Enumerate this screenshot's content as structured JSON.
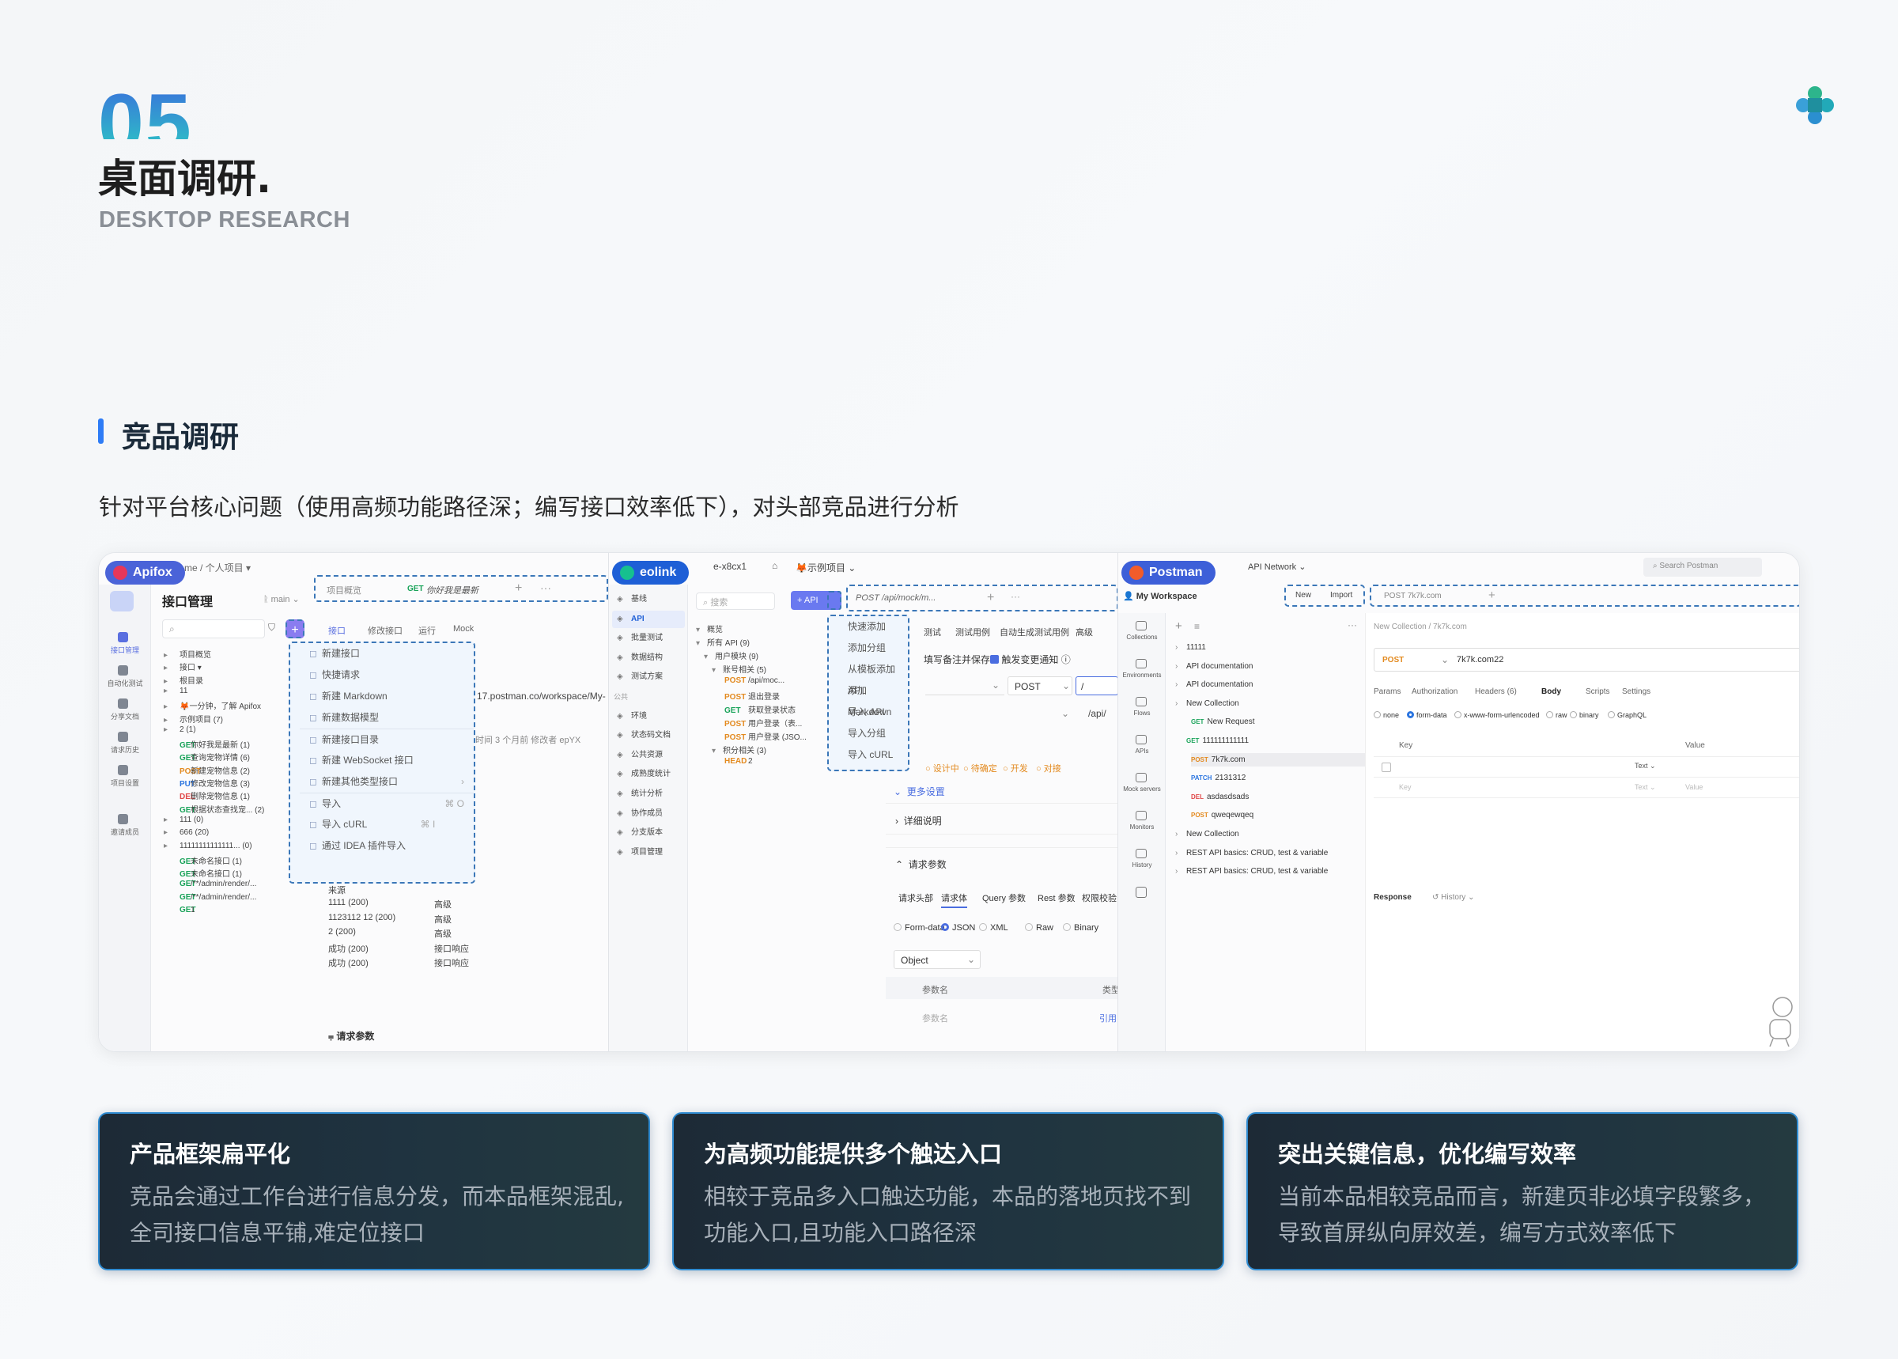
{
  "header": {
    "number": "05",
    "title": "桌面调研.",
    "subtitle": "DESKTOP RESEARCH"
  },
  "section": {
    "title": "竞品调研",
    "desc": "针对平台核心问题（使用高频功能路径深；编写接口效率低下），对头部竞品进行分析"
  },
  "apifox": {
    "brand": "Apifox",
    "breadcrumb": "me / 个人项目 ▾",
    "module_title": "接口管理",
    "branch": "main",
    "tab_overview": "项目概览",
    "tab_get": "GET",
    "tab_title": "你好我是最新",
    "subtabs": [
      "接口",
      "修改接口",
      "运行",
      "Mock"
    ],
    "sidebar": [
      "接口管理",
      "自动化测试",
      "分享文档",
      "请求历史",
      "项目设置",
      "邀请成员"
    ],
    "menu": [
      "新建接口",
      "快捷请求",
      "新建 Markdown",
      "新建数据模型",
      "新建接口目录",
      "新建 WebSocket 接口",
      "新建其他类型接口",
      "导入",
      "导入 cURL",
      "通过 IDEA 插件导入"
    ],
    "menu_shortcuts": {
      "import": "⌘ O",
      "curl": "⌘ I"
    },
    "tree": [
      {
        "m": "",
        "t": "项目概览"
      },
      {
        "m": "",
        "t": "接口 ▾"
      },
      {
        "m": "",
        "t": "根目录"
      },
      {
        "m": "",
        "t": "11"
      },
      {
        "m": "",
        "t": "🦊一分钟，了解 Apifox"
      },
      {
        "m": "",
        "t": "示例项目 (7)"
      },
      {
        "m": "",
        "t": "2 (1)"
      },
      {
        "m": "GET",
        "t": "你好我是最新 (1)"
      },
      {
        "m": "GET",
        "t": "查询宠物详情 (6)"
      },
      {
        "m": "POST",
        "t": "新建宠物信息 (2)"
      },
      {
        "m": "PUT",
        "t": "修改宠物信息 (3)"
      },
      {
        "m": "DEL",
        "t": "删除宠物信息 (1)"
      },
      {
        "m": "GET",
        "t": "根据状态查找宠... (2)"
      },
      {
        "m": "",
        "t": "111 (0)"
      },
      {
        "m": "",
        "t": "666 (20)"
      },
      {
        "m": "",
        "t": "11111111111111... (0)"
      },
      {
        "m": "GET",
        "t": "未命名接口 (1)"
      },
      {
        "m": "GET",
        "t": "未命名接口 (1)"
      },
      {
        "m": "GET",
        "t": "/**/admin/render/..."
      },
      {
        "m": "GET",
        "t": "/**/admin/render/..."
      },
      {
        "m": "GET",
        "t": "1"
      }
    ],
    "url": "17.postman.co/workspace/My-",
    "meta": "时间  3 个月前     修改者  epYX",
    "table": [
      [
        "来源",
        ""
      ],
      [
        "1111 (200)",
        "高级"
      ],
      [
        "1123112 12 (200)",
        "高级"
      ],
      [
        "2 (200)",
        "高级"
      ],
      [
        "成功 (200)",
        "接口响应"
      ],
      [
        "成功 (200)",
        "接口响应"
      ]
    ],
    "params": "请求参数"
  },
  "eolink": {
    "brand": "eolink",
    "workspace": "e-x8cx1",
    "project": "🦊示例项目",
    "sidebar": [
      "基线",
      "API",
      "批量测试",
      "数据结构",
      "测试方案",
      "公共",
      "环境",
      "状态码文档",
      "公共资源",
      "成熟度统计",
      "统计分析",
      "协作成员",
      "分支版本",
      "项目管理"
    ],
    "search": "搜索",
    "api_btn": "+ API",
    "tab": "POST  /api/mock/m...",
    "menu": [
      "快速添加",
      "添加分组",
      "从模板添加 API",
      "添加 Markdown",
      "导入 API",
      "导入分组",
      "导入 cURL"
    ],
    "tree": [
      {
        "m": "",
        "t": "概览"
      },
      {
        "m": "",
        "t": "所有 API (9)"
      },
      {
        "m": "",
        "t": "用户模块 (9)"
      },
      {
        "m": "",
        "t": "账号相关 (5)"
      },
      {
        "m": "POST",
        "t": "/api/moc..."
      },
      {
        "m": "POST",
        "t": "退出登录"
      },
      {
        "m": "GET",
        "t": "获取登录状态"
      },
      {
        "m": "POST",
        "t": "用户登录（表..."
      },
      {
        "m": "POST",
        "t": "用户登录 (JSO..."
      },
      {
        "m": "",
        "t": "积分相关 (3)"
      },
      {
        "m": "HEAD",
        "t": "2"
      }
    ],
    "subtabs": [
      "测试",
      "测试用例",
      "自动生成测试用例",
      "高级"
    ],
    "save_note": "填写备注并保存",
    "notify": "触发变更通知",
    "method": "POST",
    "path": "/",
    "path2": "/api/",
    "status": [
      "设计中",
      "待确定",
      "开发",
      "对接"
    ],
    "more": "更多设置",
    "detail": "详细说明",
    "req_params": "请求参数",
    "req_tabs": [
      "请求头部",
      "请求体",
      "Query 参数",
      "Rest 参数",
      "权限校验"
    ],
    "body_types": [
      "Form-data",
      "JSON",
      "XML",
      "Raw",
      "Binary"
    ],
    "object": "Object",
    "col_name": "参数名",
    "col_type": "类型",
    "ph_name": "参数名",
    "ref": "引用"
  },
  "postman": {
    "brand": "Postman",
    "network": "API Network",
    "search": "Search Postman",
    "workspace": "My Workspace",
    "new": "New",
    "import": "Import",
    "tab": "POST  7k7k.com",
    "sidebar": [
      "Collections",
      "Environments",
      "Flows",
      "APIs",
      "Mock servers",
      "Monitors",
      "History"
    ],
    "tree": [
      {
        "m": "",
        "t": "11111"
      },
      {
        "m": "",
        "t": "API documentation"
      },
      {
        "m": "",
        "t": "API documentation"
      },
      {
        "m": "",
        "t": "New Collection"
      },
      {
        "m": "GET",
        "t": "New Request"
      },
      {
        "m": "GET",
        "t": "111111111111"
      },
      {
        "m": "POST",
        "t": "7k7k.com"
      },
      {
        "m": "PATCH",
        "t": "2131312"
      },
      {
        "m": "DEL",
        "t": "asdasdsads"
      },
      {
        "m": "POST",
        "t": "qweqewqeq"
      },
      {
        "m": "",
        "t": "New Collection"
      },
      {
        "m": "",
        "t": "REST API basics: CRUD, test & variable"
      },
      {
        "m": "",
        "t": "REST API basics: CRUD, test & variable"
      }
    ],
    "crumb": "New Collection / 7k7k.com",
    "method": "POST",
    "url": "7k7k.com22",
    "tabs": [
      "Params",
      "Authorization",
      "Headers (6)",
      "Body",
      "Scripts",
      "Settings"
    ],
    "body": [
      "none",
      "form-data",
      "x-www-form-urlencoded",
      "raw",
      "binary",
      "GraphQL"
    ],
    "key": "Key",
    "value": "Value",
    "text": "Text",
    "response": "Response",
    "history": "History"
  },
  "cards": [
    {
      "title": "产品框架扁平化",
      "desc": "竞品会通过工作台进行信息分发，而本品框架混乱,全司接口信息平铺,难定位接口"
    },
    {
      "title": "为高频功能提供多个触达入口",
      "desc": "相较于竞品多入口触达功能，本品的落地页找不到功能入口,且功能入口路径深"
    },
    {
      "title": "突出关键信息，优化编写效率",
      "desc": "当前本品相较竞品而言，新建页非必填字段繁多，导致首屏纵向屏效差，编写方式效率低下"
    }
  ],
  "colors": {
    "apifox": "#e6375a",
    "eolink": "#1e5fd6",
    "postman": "#f25c2a",
    "accent": "#2e7cf6"
  }
}
